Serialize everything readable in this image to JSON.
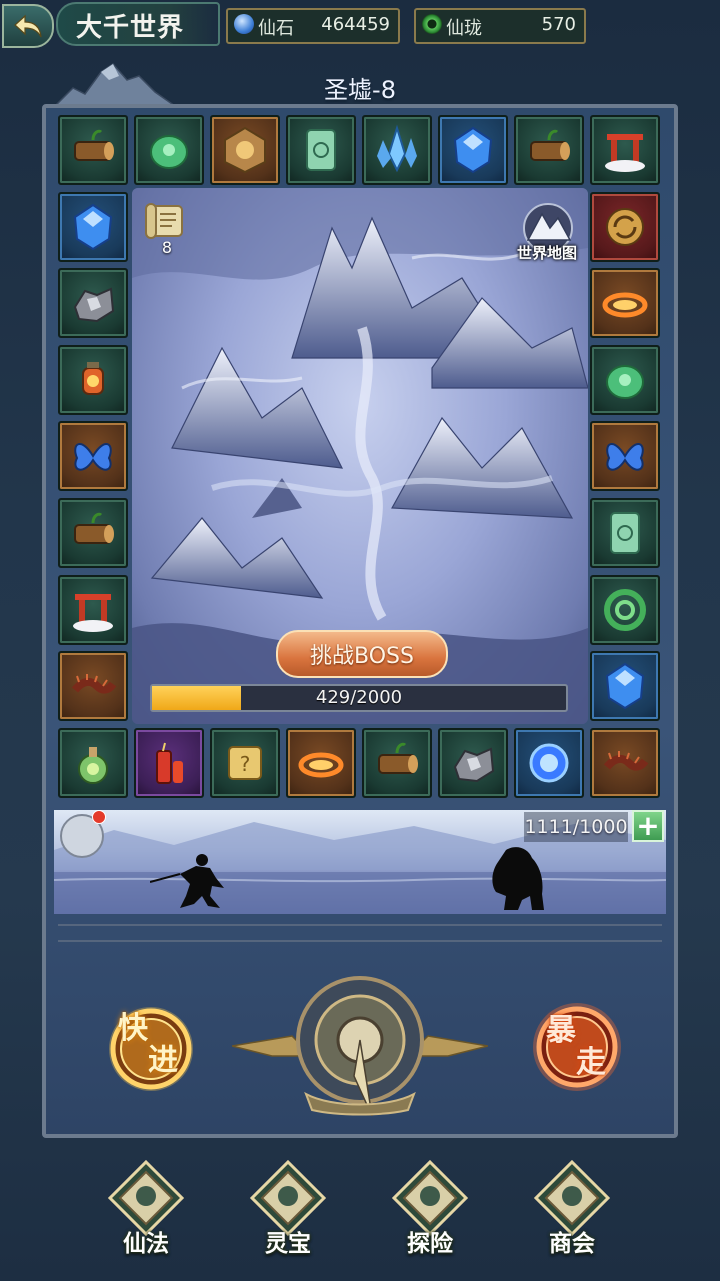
{
  "header": {
    "title": "大千世界"
  },
  "currencies": [
    {
      "icon": "blue-spirit-stone-icon",
      "label": "仙石",
      "value": "464459"
    },
    {
      "icon": "green-jade-ring-icon",
      "label": "仙珑",
      "value": "570"
    }
  ],
  "board": {
    "stage": "圣墟-8",
    "scroll_count": "8",
    "world_map_label": "世界地图",
    "boss_button": "挑战BOSS",
    "progress_text": "429/2000",
    "progress_fraction": 0.2145
  },
  "tiles": [
    {
      "icon": "wood-log-icon",
      "theme": "green"
    },
    {
      "icon": "jade-dragon-icon",
      "theme": "green"
    },
    {
      "icon": "bronze-talisman-icon",
      "theme": "orange"
    },
    {
      "icon": "jade-tablet-icon",
      "theme": "green"
    },
    {
      "icon": "blue-crystal-cluster-icon",
      "theme": "green"
    },
    {
      "icon": "blue-gem-icon",
      "theme": "blue"
    },
    {
      "icon": "wood-log-icon",
      "theme": "green"
    },
    {
      "icon": "shrine-gate-icon",
      "theme": "green"
    },
    {
      "icon": "blue-gem-icon",
      "theme": "blue"
    },
    {
      "icon": "refresh-token-icon",
      "theme": "red"
    },
    {
      "icon": "iron-ore-icon",
      "theme": "green"
    },
    {
      "icon": "fire-ring-icon",
      "theme": "orange"
    },
    {
      "icon": "lantern-censer-icon",
      "theme": "green"
    },
    {
      "icon": "jade-dragon-icon",
      "theme": "green"
    },
    {
      "icon": "blue-butterfly-icon",
      "theme": "orange"
    },
    {
      "icon": "blue-butterfly-icon",
      "theme": "orange"
    },
    {
      "icon": "wood-log-icon",
      "theme": "green"
    },
    {
      "icon": "jade-tablet-icon",
      "theme": "green"
    },
    {
      "icon": "shrine-gate-icon",
      "theme": "green"
    },
    {
      "icon": "jade-coil-icon",
      "theme": "green"
    },
    {
      "icon": "centipede-icon",
      "theme": "orange"
    },
    {
      "icon": "blue-gem-icon",
      "theme": "blue"
    },
    {
      "icon": "potion-gourd-icon",
      "theme": "green"
    },
    {
      "icon": "firecracker-icon",
      "theme": "purple"
    },
    {
      "icon": "mystery-scroll-icon",
      "theme": "green"
    },
    {
      "icon": "fire-ring-icon",
      "theme": "orange"
    },
    {
      "icon": "wood-log-icon",
      "theme": "green"
    },
    {
      "icon": "iron-ore-icon",
      "theme": "green"
    },
    {
      "icon": "blue-orb-icon",
      "theme": "blue"
    },
    {
      "icon": "centipede-icon",
      "theme": "orange"
    }
  ],
  "battle": {
    "stamina_text": "1111/1000",
    "add_symbol": "+"
  },
  "controls": {
    "fast_forward": [
      "快",
      "进"
    ],
    "rampage": [
      "暴",
      "走"
    ]
  },
  "nav": [
    {
      "label": "仙法",
      "icon": "immortal-art-icon"
    },
    {
      "label": "灵宝",
      "icon": "lotus-treasure-icon"
    },
    {
      "label": "探险",
      "icon": "expedition-icon"
    },
    {
      "label": "商会",
      "icon": "guild-shop-icon"
    }
  ],
  "colors": {
    "accent_gold": "#f0a818",
    "boss_button": "#d9743e",
    "tile_green": "#1a3a32",
    "frame": "#6c7b8e"
  }
}
